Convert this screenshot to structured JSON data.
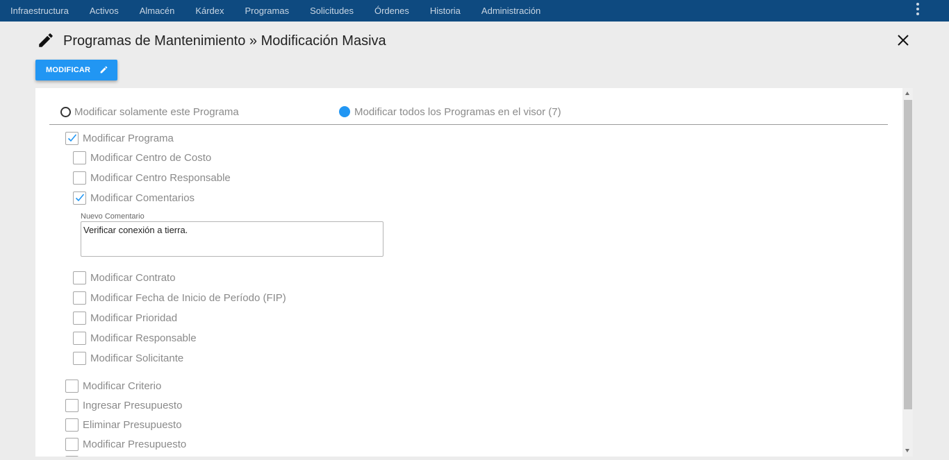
{
  "nav": {
    "items": [
      "Infraestructura",
      "Activos",
      "Almacén",
      "Kárdex",
      "Programas",
      "Solicitudes",
      "Órdenes",
      "Historia",
      "Administración"
    ],
    "menu_icon": "kebab-menu-icon"
  },
  "header": {
    "title": "Programas de Mantenimiento » Modificación Masiva",
    "title_icon": "pencil-icon",
    "close_icon": "close-icon"
  },
  "toolbar": {
    "modify_label": "MODIFICAR",
    "modify_icon": "pencil-icon",
    "accent_color": "#2196f3"
  },
  "scope": {
    "option_single": "Modificar solamente este Programa",
    "option_all": "Modificar todos los Programas en el visor (7)",
    "selected": "all"
  },
  "options": {
    "modificar_programa": "Modificar Programa",
    "centro_costo": "Modificar Centro de Costo",
    "centro_responsable": "Modificar Centro Responsable",
    "comentarios": "Modificar Comentarios",
    "nuevo_comentario_label": "Nuevo Comentario",
    "nuevo_comentario_value": "Verificar conexión a tierra.",
    "contrato": "Modificar Contrato",
    "fecha_inicio": "Modificar Fecha de Inicio de Período (FIP)",
    "prioridad": "Modificar Prioridad",
    "responsable": "Modificar Responsable",
    "solicitante": "Modificar Solicitante",
    "criterio": "Modificar Criterio",
    "ingresar_presupuesto": "Ingresar Presupuesto",
    "eliminar_presupuesto": "Eliminar Presupuesto",
    "modificar_presupuesto": "Modificar Presupuesto"
  },
  "checked": {
    "modificar_programa": true,
    "comentarios": true
  },
  "colors": {
    "nav_bg": "#0e4a80",
    "check": "#2196f3"
  }
}
